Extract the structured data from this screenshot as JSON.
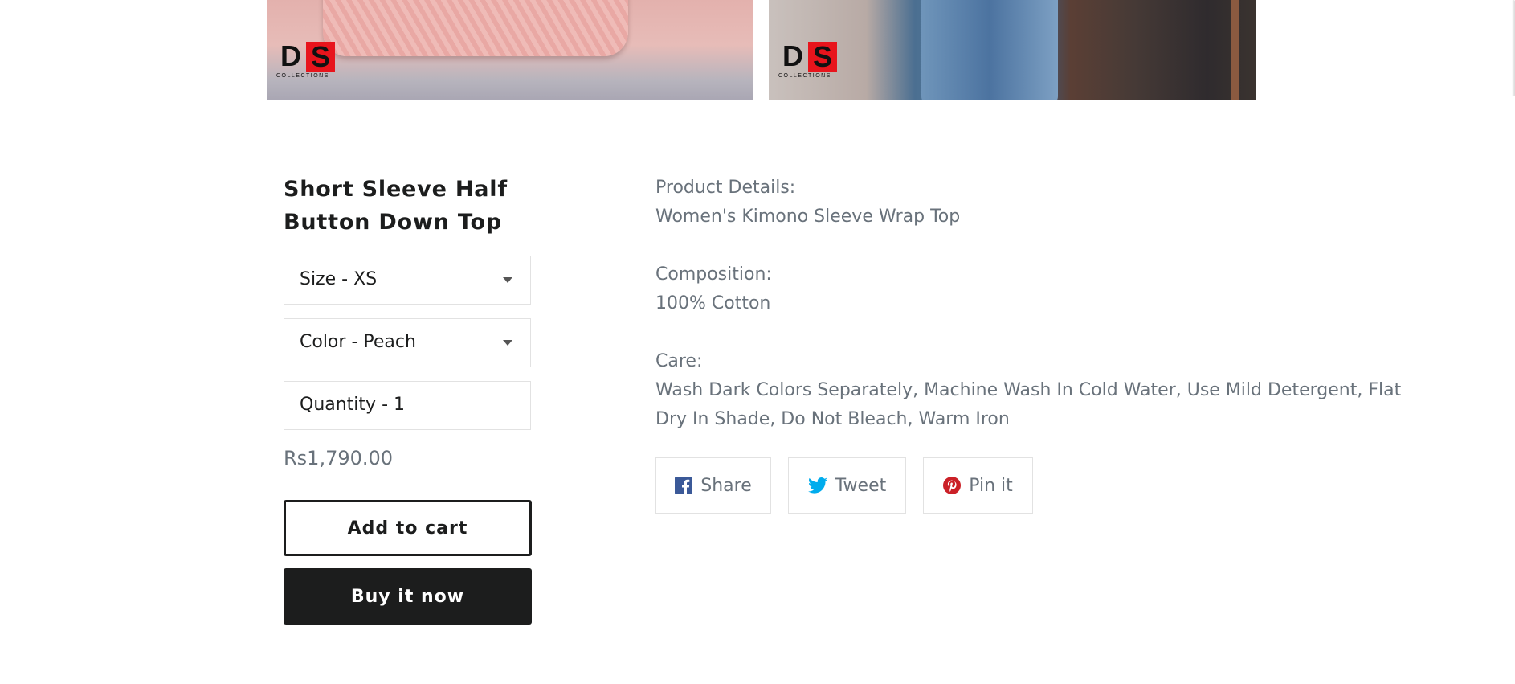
{
  "gallery": {
    "images": [
      {
        "logo_initials": [
          "D",
          "S"
        ],
        "logo_subtitle": "COLLECTIONS"
      },
      {
        "logo_initials": [
          "D",
          "S"
        ],
        "logo_subtitle": "COLLECTIONS"
      }
    ]
  },
  "product": {
    "title": "Short Sleeve Half Button Down Top",
    "price": "Rs1,790.00",
    "options": {
      "size": {
        "label": "Size",
        "separator": "-",
        "value": "XS"
      },
      "color": {
        "label": "Color",
        "separator": "-",
        "value": "Peach"
      },
      "quantity": {
        "label": "Quantity",
        "separator": "-",
        "value": "1"
      }
    },
    "add_to_cart_label": "Add to cart",
    "buy_now_label": "Buy it now"
  },
  "description": {
    "details_heading": "Product Details:",
    "details_text": "Women's Kimono Sleeve Wrap Top",
    "composition_heading": "Composition:",
    "composition_text": "100% Cotton",
    "care_heading": "Care:",
    "care_text": "Wash Dark Colors Separately, Machine Wash In Cold Water, Use Mild Detergent, Flat Dry In Shade, Do Not Bleach, Warm Iron"
  },
  "social": {
    "share_label": "Share",
    "tweet_label": "Tweet",
    "pin_label": "Pin it",
    "icons": {
      "share": "facebook-icon",
      "tweet": "twitter-icon",
      "pin": "pinterest-icon"
    },
    "colors": {
      "facebook": "#3b5998",
      "twitter": "#00aced",
      "pinterest": "#cb2027"
    }
  },
  "colors": {
    "text": "#1c1d1d",
    "muted": "#69727b",
    "border": "#e2e2e2",
    "logo_red": "#e8141c"
  }
}
